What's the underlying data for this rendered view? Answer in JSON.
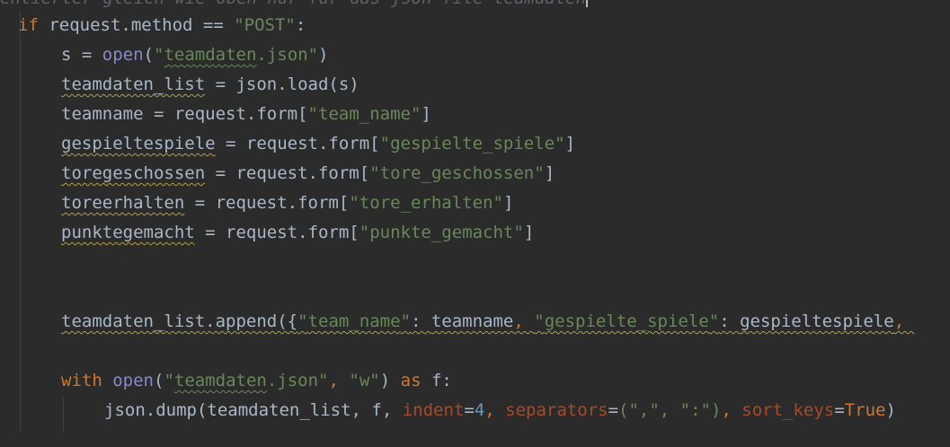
{
  "editor": {
    "cutoff_line": "entierter gleich wie oben nur für das json file teamdaten",
    "code": {
      "if_kw": "if",
      "l1_rest": " request.method == ",
      "l1_str": "\"POST\"",
      "l1_colon": ":",
      "s_assign": "s = ",
      "open": "open",
      "paren_open": "(",
      "q": "\"",
      "teamdaten": "teamdaten",
      "json_ext": ".json",
      "paren_close": ")",
      "teamdaten_list": "teamdaten_list",
      "load_rest": " = json.load(s)",
      "teamname": "teamname",
      "form_prefix": " = request.form[",
      "team_name": "team_name",
      "bracket_close": "]",
      "gespieltespiele": "gespieltespiele",
      "gespielte_spiele": "gespielte_spiele",
      "toregeschossen": "toregeschossen",
      "tore_geschossen": "tore_geschossen",
      "toreerhalten": "toreerhalten",
      "tore_erhalten": "tore_erhalten",
      "punktegemacht": "punktegemacht",
      "punkte_gemacht": "punkte_gemacht",
      "append_mid": ".append({",
      "colon_sp": ": ",
      "comma_sp": ", ",
      "with_kw": "with",
      "as_kw": "as",
      "f_colon": " f:",
      "w_str": "\"w\"",
      "json_dump": "json.dump(teamdaten_list, f, ",
      "indent_kw": "indent",
      "eq": "=",
      "four": "4",
      "separators_kw": "separators",
      "sep_args": "(\",\", \":\")",
      "sort_keys_kw": "sort_keys",
      "true_kw": "True",
      "close_paren": ")"
    }
  }
}
